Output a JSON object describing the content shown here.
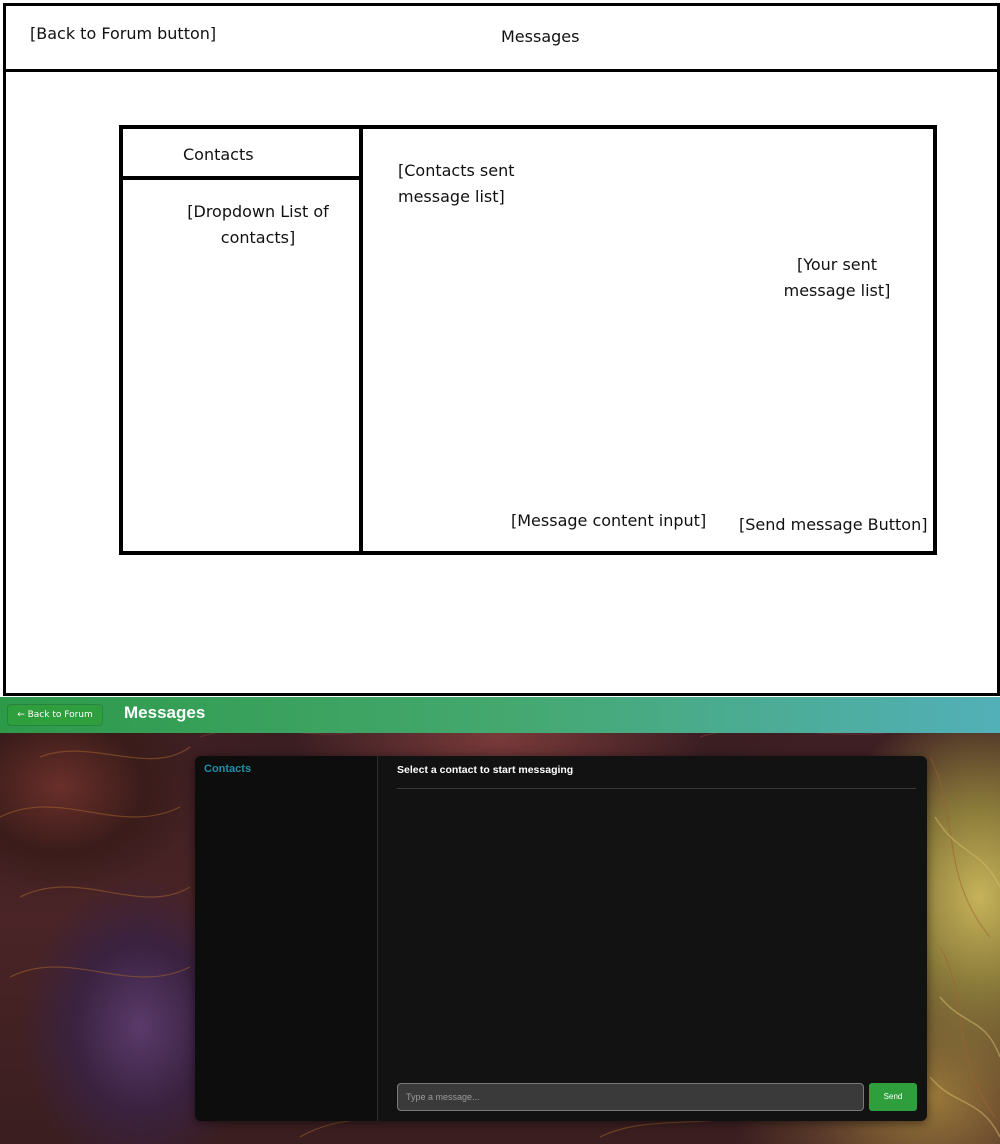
{
  "wireframe": {
    "back_button": "[Back to Forum button]",
    "title": "Messages",
    "contacts_header": "Contacts",
    "contacts_dropdown": "[Dropdown List of\ncontacts]",
    "contacts_sent_list": "[Contacts sent\nmessage list]",
    "your_sent_list": "[Your sent\nmessage list]",
    "message_input": "[Message content input]",
    "send_button": "[Send message Button]"
  },
  "app": {
    "back_button": "← Back to Forum",
    "title": "Messages",
    "contacts_title": "Contacts",
    "chat_title": "Select a contact to start messaging",
    "input_placeholder": "Type a message...",
    "send_label": "Send",
    "colors": {
      "header_gradient_start": "#2d9a4a",
      "header_gradient_end": "#52b0b8",
      "button_green": "#2e9f3c",
      "contacts_title": "#1f8fa6",
      "panel_bg": "#121212"
    }
  }
}
